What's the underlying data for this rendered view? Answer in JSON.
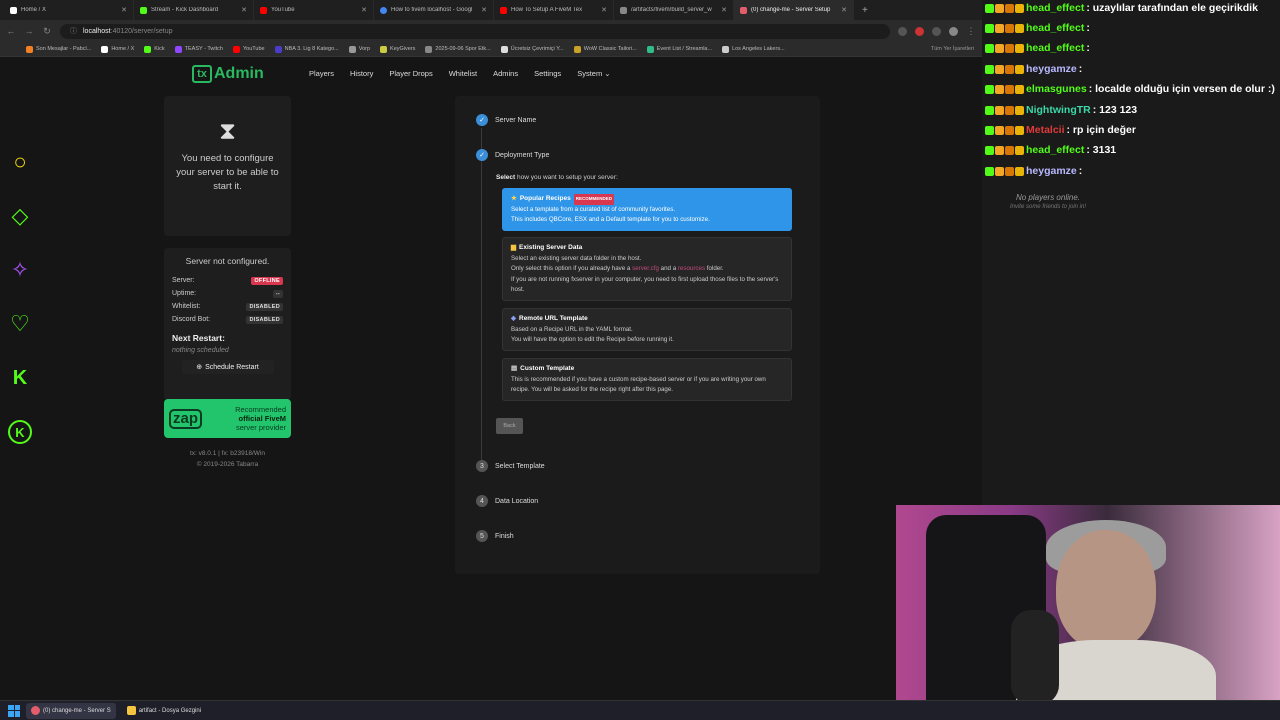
{
  "browser": {
    "tabs": [
      {
        "label": "Home / X",
        "color": "#ffffff",
        "active": false
      },
      {
        "label": "Stream - Kick Dashboard",
        "color": "#53fc18",
        "active": false
      },
      {
        "label": "YouTube",
        "color": "#ff0000",
        "active": false
      },
      {
        "label": "How to fivem localhost - Googl",
        "color": "#4285f4",
        "active": false
      },
      {
        "label": "How To Setup A FiveM Tex",
        "color": "#ff0000",
        "active": false
      },
      {
        "label": "/artifacts/fivem/build_server_w",
        "color": "#888888",
        "active": false
      },
      {
        "label": "(0) change-me - Server Setup",
        "color": "#e35d6a",
        "active": true
      }
    ],
    "new_tab": "+",
    "url_host": "localhost",
    "url_path": ":40120/server/setup",
    "bookmarks": [
      {
        "label": "Son Mesajlar - Pabcl...",
        "color": "#f48024"
      },
      {
        "label": "Home / X",
        "color": "#ffffff"
      },
      {
        "label": "Kick",
        "color": "#53fc18"
      },
      {
        "label": "TEASY - Twitch",
        "color": "#9146ff"
      },
      {
        "label": "YouTube",
        "color": "#ff0000"
      },
      {
        "label": "NBA 3. Lig 8 Katego...",
        "color": "#4b3cc9"
      },
      {
        "label": "Vorp",
        "color": "#999999"
      },
      {
        "label": "KeyGivers",
        "color": "#cccc44"
      },
      {
        "label": "2025-09-06 Spor Etk...",
        "color": "#888888"
      },
      {
        "label": "Ücretsiz Çevrimiçi Y...",
        "color": "#dddddd"
      },
      {
        "label": "WoW Classic Tailori...",
        "color": "#c9a227"
      },
      {
        "label": "Event List / Streamla...",
        "color": "#33bb88"
      },
      {
        "label": "Los Angeles Lakers...",
        "color": "#cccccc"
      }
    ],
    "bookmarks_right": "Tüm Yer İşaretleri"
  },
  "txadmin": {
    "logo_tx": "tx",
    "logo_admin": "Admin",
    "nav": [
      "Players",
      "History",
      "Player Drops",
      "Whitelist",
      "Admins",
      "Settings",
      "System ⌄"
    ],
    "need_config": "You need to configure your server to be able to start it.",
    "status": {
      "title": "Server not configured.",
      "rows": [
        {
          "label": "Server:",
          "value": "OFFLINE",
          "kind": "red"
        },
        {
          "label": "Uptime:",
          "value": "--",
          "kind": "dark"
        },
        {
          "label": "Whitelist:",
          "value": "DISABLED",
          "kind": "dark"
        },
        {
          "label": "Discord Bot:",
          "value": "DISABLED",
          "kind": "dark"
        }
      ],
      "next_restart": "Next Restart:",
      "nothing": "nothing scheduled",
      "schedule_btn": "Schedule Restart"
    },
    "zap": {
      "logo": "zap",
      "line1": "Recommended",
      "line2": "official FiveM",
      "line3": "server provider"
    },
    "version": "tx: v8.0.1 | fx: b23918/Win",
    "copyright": "© 2019-2026 Tabarra"
  },
  "wizard": {
    "steps": [
      "Server Name",
      "Deployment Type",
      "Select Template",
      "Data Location",
      "Finish"
    ],
    "step_nums": [
      "✓",
      "✓",
      "3",
      "4",
      "5"
    ],
    "select_bold": "Select",
    "select_rest": "how you want to setup your server:",
    "options": [
      {
        "icon": "★",
        "title": "Popular Recipes",
        "badge": "RECOMMENDED",
        "lines": [
          "Select a template from a curated list of community favorites.",
          "This includes QBCore, ESX and a Default template for you to customize."
        ]
      },
      {
        "icon": "▆",
        "title": "Existing Server Data",
        "lines": [
          "Select an existing server data folder in the host."
        ],
        "line2_a": "Only select this option if you already have a",
        "line2_hl1": "server.cfg",
        "line2_b": "and a",
        "line2_hl2": "resources",
        "line2_c": "folder.",
        "line3": "If you are not running fxserver in your computer, you need to first upload those files to the server's host."
      },
      {
        "icon": "◈",
        "title": "Remote URL Template",
        "lines": [
          "Based on a Recipe URL in the YAML format.",
          "You will have the option to edit the Recipe before running it."
        ]
      },
      {
        "icon": "▤",
        "title": "Custom Template",
        "lines": [
          "This is recommended if you have a custom recipe-based server or if you are writing your own recipe. You will be asked for the recipe right after this page."
        ]
      }
    ],
    "back": "Back"
  },
  "chat": {
    "messages": [
      {
        "user": "head_effect",
        "color": "#53fc18",
        "text": ": uzaylılar tarafından ele geçirikdik"
      },
      {
        "user": "head_effect",
        "color": "#53fc18",
        "text": ":"
      },
      {
        "user": "head_effect",
        "color": "#53fc18",
        "text": ":"
      },
      {
        "user": "heygamze",
        "color": "#b8b8ff",
        "text": ":"
      },
      {
        "user": "elmasgunes",
        "color": "#53fc18",
        "text": ": localde olduğu için versen de olur :)"
      },
      {
        "user": "NightwingTR",
        "color": "#3bd8a8",
        "text": ": 123 123"
      },
      {
        "user": "Metalcii",
        "color": "#e03a3a",
        "text": ": rp için değer"
      },
      {
        "user": "head_effect",
        "color": "#53fc18",
        "text": ": 3131"
      },
      {
        "user": "heygamze",
        "color": "#b8b8ff",
        "text": ":"
      }
    ],
    "no_players": "No players online.",
    "invite": "Invite some friends to join in!"
  },
  "taskbar": {
    "items": [
      {
        "label": "(0) change-me - Server S",
        "color": "#e35d6a"
      },
      {
        "label": "artifact - Dosya Gezgini",
        "color": "#f5c542"
      }
    ]
  },
  "colors": {
    "accent": "#2f95e8",
    "brand": "#29b960",
    "offline": "#d9364f"
  }
}
